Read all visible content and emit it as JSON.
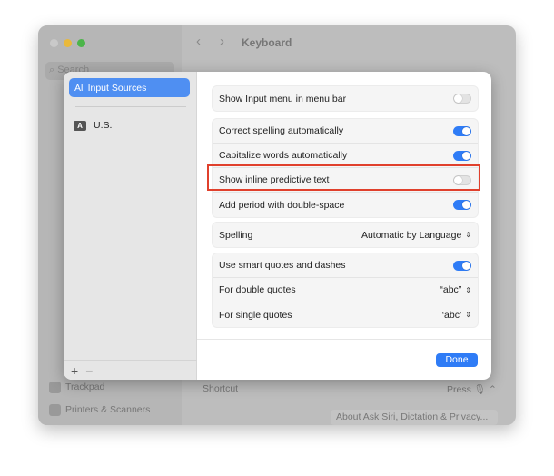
{
  "window": {
    "title": "Keyboard",
    "search_placeholder": "Search",
    "sidebar": [
      "Trackpad",
      "Printers & Scanners"
    ],
    "shortcut_label": "Shortcut",
    "shortcut_value": "Press 🎙",
    "about_button": "About Ask Siri, Dictation & Privacy..."
  },
  "sheet": {
    "sources": {
      "selected": "All Input Sources",
      "items": [
        {
          "badge": "A",
          "label": "U.S."
        }
      ],
      "add": "+",
      "remove": "−"
    },
    "rows": [
      {
        "label": "Show Input menu in menu bar",
        "on": false
      },
      {
        "label": "Correct spelling automatically",
        "on": true
      },
      {
        "label": "Capitalize words automatically",
        "on": true
      },
      {
        "label": "Show inline predictive text",
        "on": false
      },
      {
        "label": "Add period with double-space",
        "on": true
      }
    ],
    "spelling": {
      "label": "Spelling",
      "value": "Automatic by Language"
    },
    "quotes": {
      "smart": {
        "label": "Use smart quotes and dashes",
        "on": true
      },
      "double": {
        "label": "For double quotes",
        "value": "“abc”"
      },
      "single": {
        "label": "For single quotes",
        "value": "‘abc’"
      }
    },
    "done": "Done"
  },
  "colors": {
    "accent": "#2f7cf6",
    "highlight": "#e0402c"
  }
}
